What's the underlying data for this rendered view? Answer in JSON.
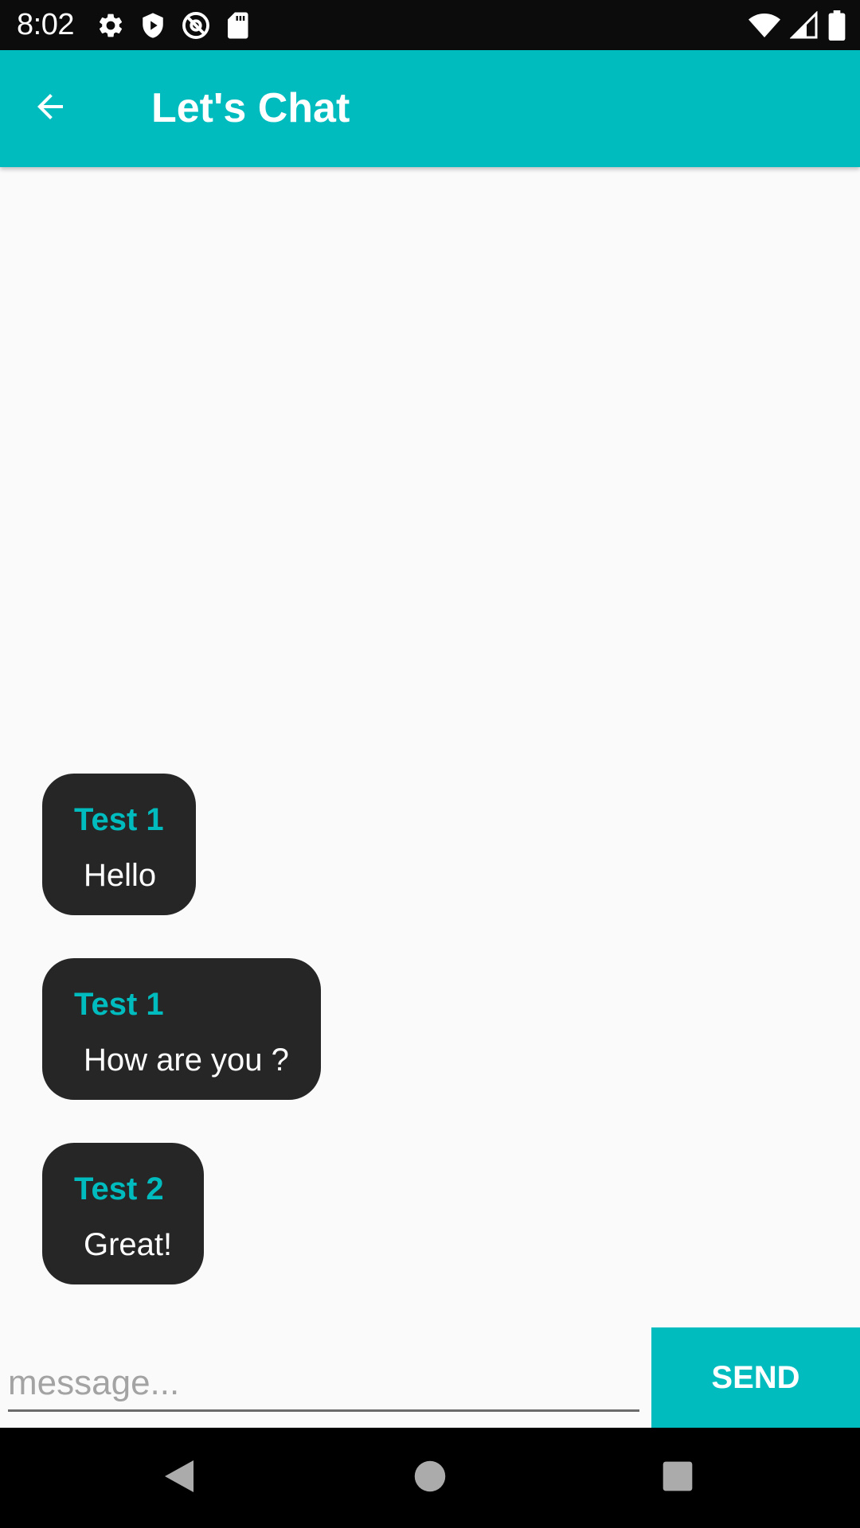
{
  "status_bar": {
    "time": "8:02",
    "left_icons": [
      "gear-icon",
      "shield-play-icon",
      "at-sign-icon",
      "sd-card-icon"
    ],
    "right_icons": [
      "wifi-icon",
      "cell-signal-icon",
      "battery-icon"
    ]
  },
  "app_bar": {
    "title": "Let's Chat",
    "back_icon": "arrow-back-icon",
    "color": "#00bcbf"
  },
  "messages": [
    {
      "sender": "Test 1",
      "text": "Hello"
    },
    {
      "sender": "Test 1",
      "text": "How are you ?"
    },
    {
      "sender": "Test 2",
      "text": "Great!"
    }
  ],
  "input": {
    "placeholder": "message...",
    "value": "",
    "send_label": "SEND"
  },
  "nav_bar": {
    "icons": [
      "back-triangle-icon",
      "home-circle-icon",
      "recents-square-icon"
    ]
  },
  "colors": {
    "accent": "#00bcbf",
    "bubble": "#262626",
    "background": "#fafafa"
  }
}
